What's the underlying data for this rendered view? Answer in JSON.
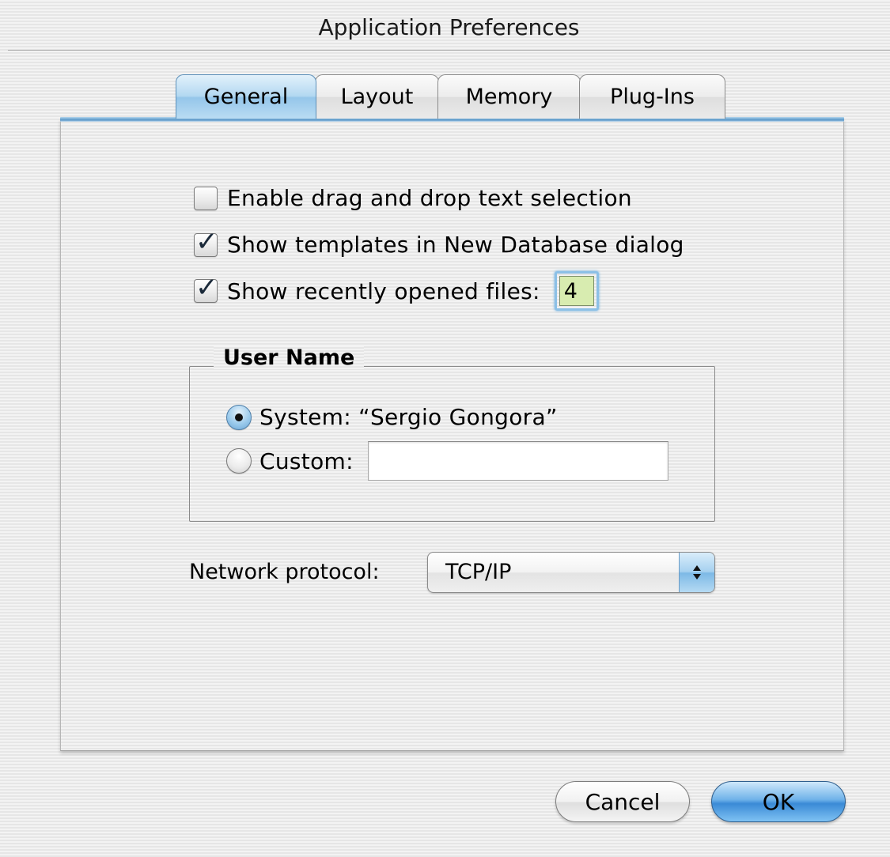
{
  "window": {
    "title": "Application Preferences"
  },
  "tabs": [
    {
      "label": "General",
      "selected": true
    },
    {
      "label": "Layout",
      "selected": false
    },
    {
      "label": "Memory",
      "selected": false
    },
    {
      "label": "Plug-Ins",
      "selected": false
    }
  ],
  "options": {
    "drag_drop": {
      "label": "Enable drag and drop text selection",
      "checked": false
    },
    "show_templates": {
      "label": "Show templates in New Database dialog",
      "checked": true
    },
    "show_recent": {
      "label": "Show recently opened files:",
      "checked": true,
      "count": "4"
    }
  },
  "user_name": {
    "title": "User Name",
    "system_label": "System: “Sergio Gongora”",
    "system_selected": true,
    "custom_label": "Custom:",
    "custom_value": ""
  },
  "network": {
    "label": "Network protocol:",
    "selected": "TCP/IP"
  },
  "buttons": {
    "cancel": "Cancel",
    "ok": "OK"
  },
  "colors": {
    "accent": "#6fb2e9",
    "field_highlight": "#d8ecb0"
  }
}
